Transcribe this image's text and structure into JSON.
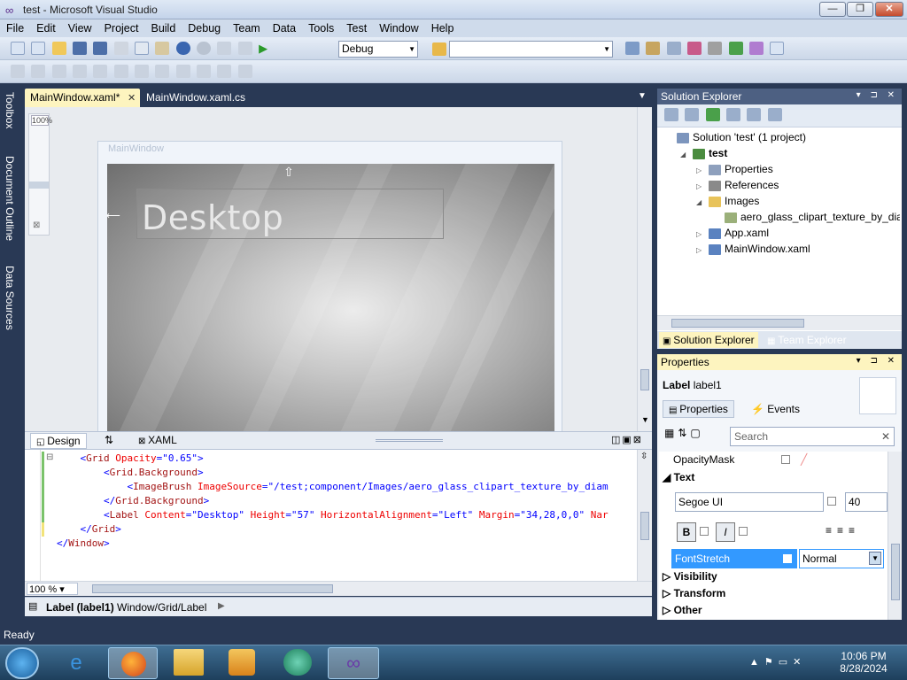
{
  "window": {
    "title": "test - Microsoft Visual Studio",
    "controls": {
      "minimize": "—",
      "maximize": "❐",
      "close": "✕"
    }
  },
  "menu": [
    "File",
    "Edit",
    "View",
    "Project",
    "Build",
    "Debug",
    "Team",
    "Data",
    "Tools",
    "Test",
    "Window",
    "Help"
  ],
  "toolbar": {
    "config_value": "Debug",
    "platform_value": ""
  },
  "left_tabs": [
    "Toolbox",
    "Document Outline",
    "Data Sources"
  ],
  "doc_tabs": [
    {
      "label": "MainWindow.xaml*",
      "active": true
    },
    {
      "label": "MainWindow.xaml.cs",
      "active": false
    }
  ],
  "designer": {
    "zoom": "100%",
    "window_title": "MainWindow",
    "label_text": "Desktop"
  },
  "split": {
    "design_tab": "Design",
    "swap_icon": "⇅",
    "xaml_tab": "XAML"
  },
  "code_lines": [
    {
      "indent": "    ",
      "parts": [
        [
          "br",
          "<"
        ],
        [
          "tag",
          "Grid"
        ],
        [
          "attr",
          " Opacity"
        ],
        [
          "br",
          "=\""
        ],
        [
          "val",
          "0.65"
        ],
        [
          "br",
          "\">"
        ]
      ]
    },
    {
      "indent": "        ",
      "parts": [
        [
          "br",
          "<"
        ],
        [
          "tag",
          "Grid.Background"
        ],
        [
          "br",
          ">"
        ]
      ]
    },
    {
      "indent": "            ",
      "parts": [
        [
          "br",
          "<"
        ],
        [
          "tag",
          "ImageBrush"
        ],
        [
          "attr",
          " ImageSource"
        ],
        [
          "br",
          "=\""
        ],
        [
          "val",
          "/test;component/Images/aero_glass_clipart_texture_by_diam"
        ]
      ]
    },
    {
      "indent": "        ",
      "parts": [
        [
          "br",
          "</"
        ],
        [
          "tag",
          "Grid.Background"
        ],
        [
          "br",
          ">"
        ]
      ]
    },
    {
      "indent": "        ",
      "parts": [
        [
          "br",
          "<"
        ],
        [
          "tag",
          "Label"
        ],
        [
          "attr",
          " Content"
        ],
        [
          "br",
          "=\""
        ],
        [
          "val",
          "Desktop"
        ],
        [
          "br",
          "\""
        ],
        [
          "attr",
          " Height"
        ],
        [
          "br",
          "=\""
        ],
        [
          "val",
          "57"
        ],
        [
          "br",
          "\""
        ],
        [
          "attr",
          " HorizontalAlignment"
        ],
        [
          "br",
          "=\""
        ],
        [
          "val",
          "Left"
        ],
        [
          "br",
          "\""
        ],
        [
          "attr",
          " Margin"
        ],
        [
          "br",
          "=\""
        ],
        [
          "val",
          "34,28,0,0"
        ],
        [
          "br",
          "\""
        ],
        [
          "attr",
          " Nar"
        ]
      ]
    },
    {
      "indent": "    ",
      "parts": [
        [
          "br",
          "</"
        ],
        [
          "tag",
          "Grid"
        ],
        [
          "br",
          ">"
        ]
      ]
    },
    {
      "indent": "",
      "parts": [
        [
          "br",
          "</"
        ],
        [
          "tag",
          "Window"
        ],
        [
          "br",
          ">"
        ]
      ]
    }
  ],
  "editor": {
    "zoom": "100 %"
  },
  "pathbar": {
    "element": "Label (label1)",
    "path": "Window/Grid/Label"
  },
  "solution_explorer": {
    "title": "Solution Explorer",
    "items": [
      {
        "label": "Solution 'test' (1 project)",
        "level": 0,
        "expander": "",
        "bold": false,
        "icon": "#7c95bd"
      },
      {
        "label": "test",
        "level": 1,
        "expander": "◢",
        "bold": true,
        "icon": "#4a8c3f"
      },
      {
        "label": "Properties",
        "level": 2,
        "expander": "▷",
        "bold": false,
        "icon": "#8ea0bd"
      },
      {
        "label": "References",
        "level": 2,
        "expander": "▷",
        "bold": false,
        "icon": "#8a8a8a"
      },
      {
        "label": "Images",
        "level": 2,
        "expander": "◢",
        "bold": false,
        "icon": "#e8c35a"
      },
      {
        "label": "aero_glass_clipart_texture_by_diamo",
        "level": 3,
        "expander": "",
        "bold": false,
        "icon": "#9bb07a"
      },
      {
        "label": "App.xaml",
        "level": 2,
        "expander": "▷",
        "bold": false,
        "icon": "#5a82c0"
      },
      {
        "label": "MainWindow.xaml",
        "level": 2,
        "expander": "▷",
        "bold": false,
        "icon": "#5a82c0"
      }
    ],
    "tabs": [
      "Solution Explorer",
      "Team Explorer"
    ]
  },
  "properties": {
    "title": "Properties",
    "element_type": "Label",
    "element_name": "label1",
    "tab_properties": "Properties",
    "tab_events": "Events",
    "search_placeholder": "Search",
    "opacity_mask": "OpacityMask",
    "section_text": "Text",
    "font_family": "Segoe UI",
    "font_size": "40",
    "bold": "B",
    "italic": "I",
    "fontstretch_label": "FontStretch",
    "fontstretch_value": "Normal",
    "sections": [
      "Visibility",
      "Transform",
      "Other"
    ]
  },
  "status": {
    "text": "Ready"
  },
  "taskbar": {
    "time": "10:06 PM",
    "date": "8/28/2024"
  },
  "colors": {
    "vs_dark": "#293955",
    "tab_active": "#fdf4bf",
    "panel_head": "#4d6082",
    "selected_row": "#3399ff"
  }
}
